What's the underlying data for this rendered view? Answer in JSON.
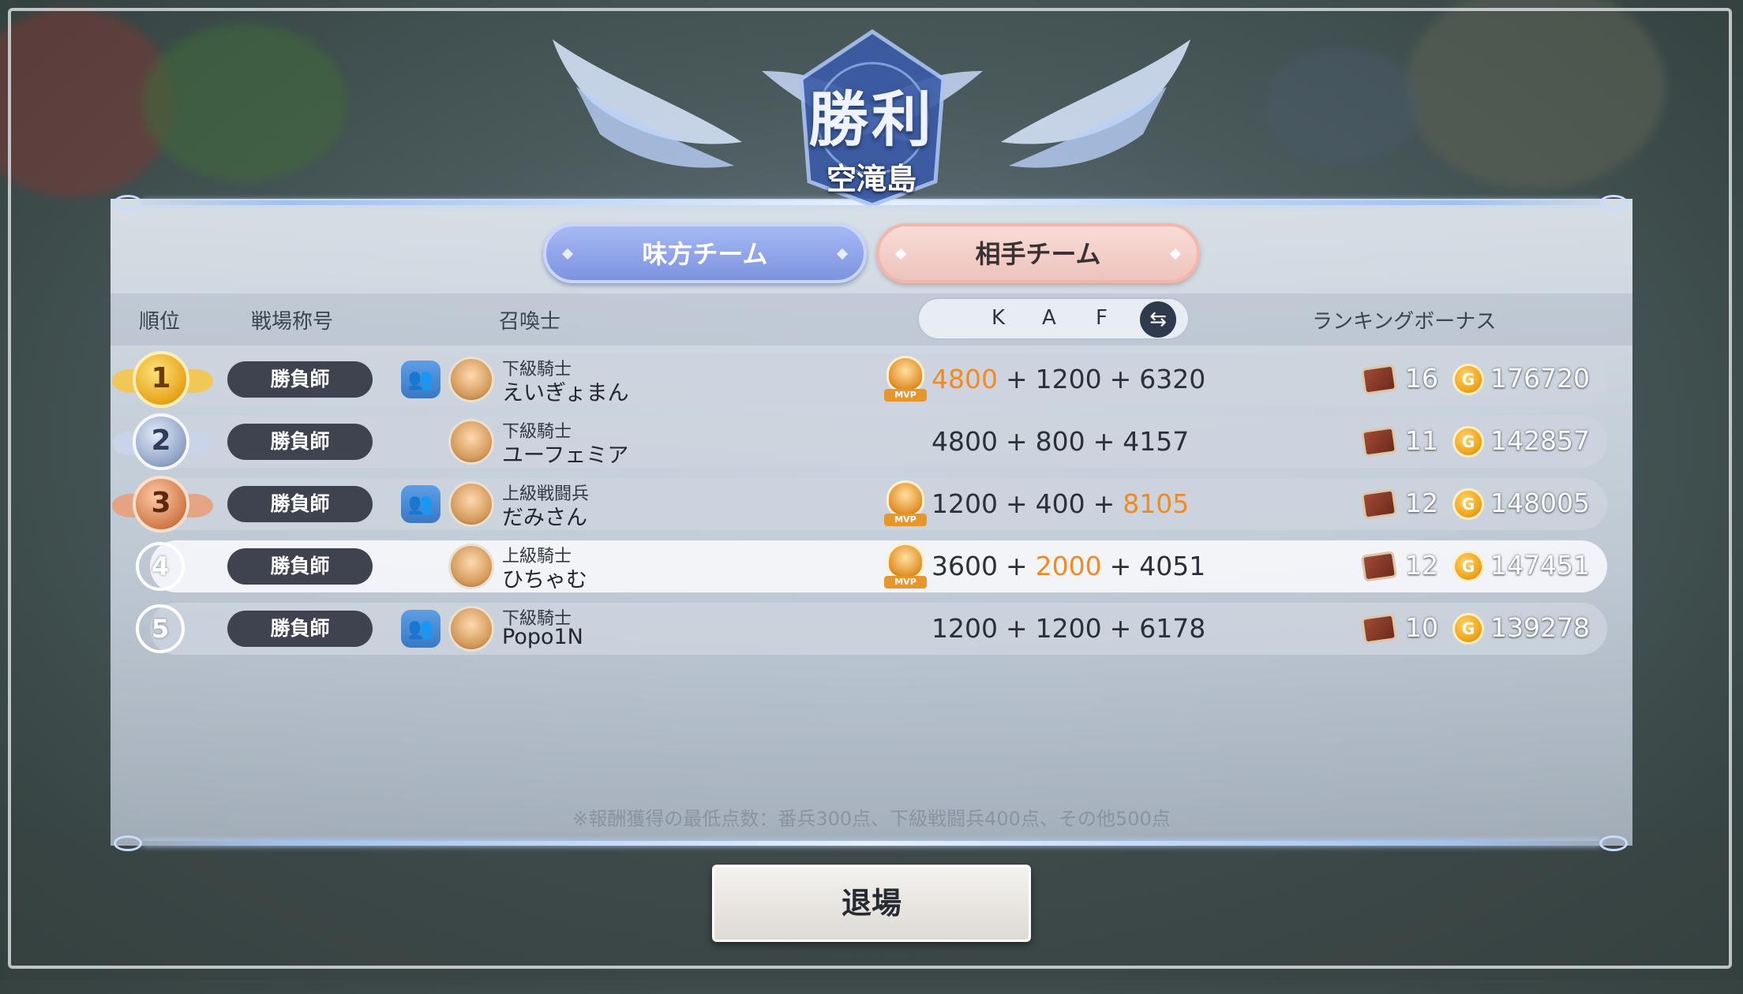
{
  "result": {
    "title": "勝利",
    "map": "空滝島"
  },
  "tabs": {
    "ally": "味方チーム",
    "enemy": "相手チーム"
  },
  "headers": {
    "rank": "順位",
    "battle_title": "戦場称号",
    "summoner": "召喚士",
    "k": "K",
    "a": "A",
    "f": "F",
    "bonus": "ランキングボーナス"
  },
  "rows": [
    {
      "rank": "1",
      "badge": "勝負師",
      "party": true,
      "rank_title": "下級騎士",
      "name": "えいぎょまん",
      "mvp": true,
      "k": "4800",
      "a": "1200",
      "f": "6320",
      "hl": "k",
      "chests": "16",
      "gold": "176720"
    },
    {
      "rank": "2",
      "badge": "勝負師",
      "party": false,
      "rank_title": "下級騎士",
      "name": "ユーフェミア",
      "mvp": false,
      "k": "4800",
      "a": "800",
      "f": "4157",
      "hl": "",
      "chests": "11",
      "gold": "142857"
    },
    {
      "rank": "3",
      "badge": "勝負師",
      "party": true,
      "rank_title": "上級戦闘兵",
      "name": "だみさん",
      "mvp": true,
      "k": "1200",
      "a": "400",
      "f": "8105",
      "hl": "f",
      "chests": "12",
      "gold": "148005"
    },
    {
      "rank": "4",
      "badge": "勝負師",
      "party": false,
      "rank_title": "上級騎士",
      "name": "ひちゃむ",
      "mvp": true,
      "k": "3600",
      "a": "2000",
      "f": "4051",
      "hl": "a",
      "chests": "12",
      "gold": "147451"
    },
    {
      "rank": "5",
      "badge": "勝負師",
      "party": true,
      "rank_title": "下級騎士",
      "name": "Popo1N",
      "mvp": false,
      "k": "1200",
      "a": "1200",
      "f": "6178",
      "hl": "",
      "chests": "10",
      "gold": "139278"
    }
  ],
  "icons": {
    "party": "party-icon",
    "mvp": "mvp-badge-icon",
    "chest": "treasure-chest-icon",
    "coin": "gold-coin-icon",
    "swap": "swap-arrows-icon"
  },
  "colors": {
    "highlight_score": "#f28a22",
    "ally_tab": "#7d93e0",
    "enemy_tab": "#eec3bd",
    "title_badge": "#3e434f"
  },
  "mvp_label": "MVP",
  "coin_glyph": "G",
  "note": "※報酬獲得の最低点数：番兵300点、下級戦闘兵400点、その他500点",
  "exit_button": "退場"
}
